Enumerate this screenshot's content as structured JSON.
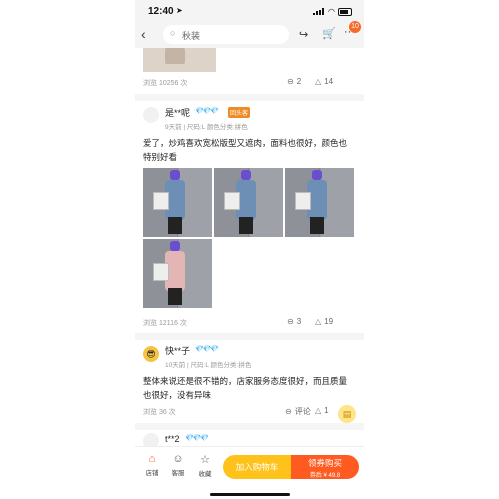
{
  "status": {
    "time": "12:40",
    "location_icon": "location-arrow-icon"
  },
  "topbar": {
    "search_placeholder": "秋装",
    "cart_badge": "10"
  },
  "prev_review": {
    "views": "浏览 10256 次",
    "comments": "2",
    "likes": "14"
  },
  "reviews": [
    {
      "name": "是**呢",
      "diamonds": "💎💎💎",
      "tag": "回头客",
      "meta": "9天前 | 尺码:L 颜色分类:拼色",
      "content": "爱了，炒鸡喜欢宽松版型又遮肉，面料也很好，颜色也特别好看",
      "views": "浏览 12116 次",
      "comments": "3",
      "likes": "19"
    },
    {
      "name": "快**子",
      "diamonds": "💎💎💎",
      "meta": "10天前 | 尺码:L 颜色分类:拼色",
      "content": "整体来说还是很不错的，店家服务态度很好，而且质量也很好，没有异味",
      "views": "浏览 36 次",
      "comment_label": "评论",
      "likes": "1"
    },
    {
      "name": "t**2",
      "diamonds": "💎💎💎"
    }
  ],
  "bottom": {
    "shop": "店铺",
    "service": "客服",
    "favorite": "收藏",
    "add_cart": "加入购物车",
    "buy": "领券购买",
    "coupon_price": "券后 ¥ 49.8"
  },
  "colors": {
    "accent": "#ff5a1f",
    "cart_button": "#ffc21a",
    "diamond": "#4aa8ee",
    "tag": "#f08a24"
  }
}
